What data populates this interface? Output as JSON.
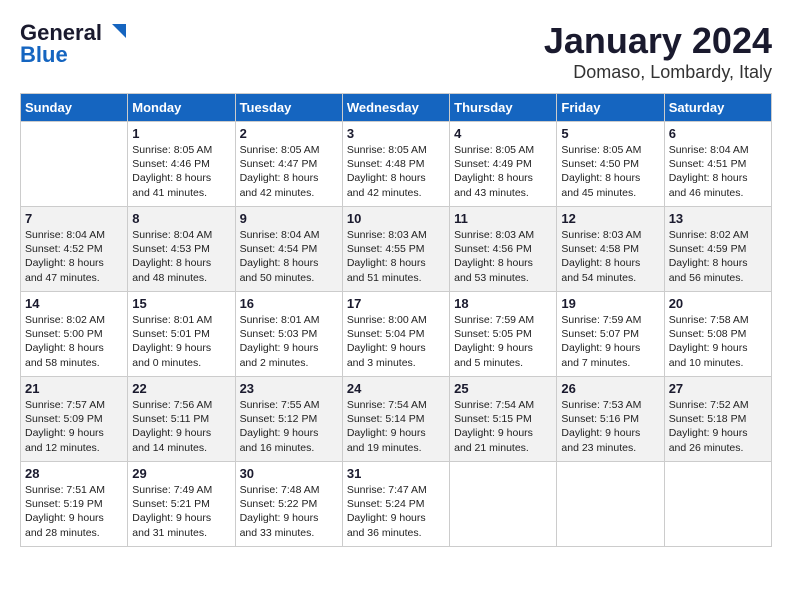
{
  "header": {
    "logo_general": "General",
    "logo_blue": "Blue",
    "month": "January 2024",
    "location": "Domaso, Lombardy, Italy"
  },
  "days_of_week": [
    "Sunday",
    "Monday",
    "Tuesday",
    "Wednesday",
    "Thursday",
    "Friday",
    "Saturday"
  ],
  "weeks": [
    [
      {
        "day": "",
        "info": ""
      },
      {
        "day": "1",
        "info": "Sunrise: 8:05 AM\nSunset: 4:46 PM\nDaylight: 8 hours\nand 41 minutes."
      },
      {
        "day": "2",
        "info": "Sunrise: 8:05 AM\nSunset: 4:47 PM\nDaylight: 8 hours\nand 42 minutes."
      },
      {
        "day": "3",
        "info": "Sunrise: 8:05 AM\nSunset: 4:48 PM\nDaylight: 8 hours\nand 42 minutes."
      },
      {
        "day": "4",
        "info": "Sunrise: 8:05 AM\nSunset: 4:49 PM\nDaylight: 8 hours\nand 43 minutes."
      },
      {
        "day": "5",
        "info": "Sunrise: 8:05 AM\nSunset: 4:50 PM\nDaylight: 8 hours\nand 45 minutes."
      },
      {
        "day": "6",
        "info": "Sunrise: 8:04 AM\nSunset: 4:51 PM\nDaylight: 8 hours\nand 46 minutes."
      }
    ],
    [
      {
        "day": "7",
        "info": "Sunrise: 8:04 AM\nSunset: 4:52 PM\nDaylight: 8 hours\nand 47 minutes."
      },
      {
        "day": "8",
        "info": "Sunrise: 8:04 AM\nSunset: 4:53 PM\nDaylight: 8 hours\nand 48 minutes."
      },
      {
        "day": "9",
        "info": "Sunrise: 8:04 AM\nSunset: 4:54 PM\nDaylight: 8 hours\nand 50 minutes."
      },
      {
        "day": "10",
        "info": "Sunrise: 8:03 AM\nSunset: 4:55 PM\nDaylight: 8 hours\nand 51 minutes."
      },
      {
        "day": "11",
        "info": "Sunrise: 8:03 AM\nSunset: 4:56 PM\nDaylight: 8 hours\nand 53 minutes."
      },
      {
        "day": "12",
        "info": "Sunrise: 8:03 AM\nSunset: 4:58 PM\nDaylight: 8 hours\nand 54 minutes."
      },
      {
        "day": "13",
        "info": "Sunrise: 8:02 AM\nSunset: 4:59 PM\nDaylight: 8 hours\nand 56 minutes."
      }
    ],
    [
      {
        "day": "14",
        "info": "Sunrise: 8:02 AM\nSunset: 5:00 PM\nDaylight: 8 hours\nand 58 minutes."
      },
      {
        "day": "15",
        "info": "Sunrise: 8:01 AM\nSunset: 5:01 PM\nDaylight: 9 hours\nand 0 minutes."
      },
      {
        "day": "16",
        "info": "Sunrise: 8:01 AM\nSunset: 5:03 PM\nDaylight: 9 hours\nand 2 minutes."
      },
      {
        "day": "17",
        "info": "Sunrise: 8:00 AM\nSunset: 5:04 PM\nDaylight: 9 hours\nand 3 minutes."
      },
      {
        "day": "18",
        "info": "Sunrise: 7:59 AM\nSunset: 5:05 PM\nDaylight: 9 hours\nand 5 minutes."
      },
      {
        "day": "19",
        "info": "Sunrise: 7:59 AM\nSunset: 5:07 PM\nDaylight: 9 hours\nand 7 minutes."
      },
      {
        "day": "20",
        "info": "Sunrise: 7:58 AM\nSunset: 5:08 PM\nDaylight: 9 hours\nand 10 minutes."
      }
    ],
    [
      {
        "day": "21",
        "info": "Sunrise: 7:57 AM\nSunset: 5:09 PM\nDaylight: 9 hours\nand 12 minutes."
      },
      {
        "day": "22",
        "info": "Sunrise: 7:56 AM\nSunset: 5:11 PM\nDaylight: 9 hours\nand 14 minutes."
      },
      {
        "day": "23",
        "info": "Sunrise: 7:55 AM\nSunset: 5:12 PM\nDaylight: 9 hours\nand 16 minutes."
      },
      {
        "day": "24",
        "info": "Sunrise: 7:54 AM\nSunset: 5:14 PM\nDaylight: 9 hours\nand 19 minutes."
      },
      {
        "day": "25",
        "info": "Sunrise: 7:54 AM\nSunset: 5:15 PM\nDaylight: 9 hours\nand 21 minutes."
      },
      {
        "day": "26",
        "info": "Sunrise: 7:53 AM\nSunset: 5:16 PM\nDaylight: 9 hours\nand 23 minutes."
      },
      {
        "day": "27",
        "info": "Sunrise: 7:52 AM\nSunset: 5:18 PM\nDaylight: 9 hours\nand 26 minutes."
      }
    ],
    [
      {
        "day": "28",
        "info": "Sunrise: 7:51 AM\nSunset: 5:19 PM\nDaylight: 9 hours\nand 28 minutes."
      },
      {
        "day": "29",
        "info": "Sunrise: 7:49 AM\nSunset: 5:21 PM\nDaylight: 9 hours\nand 31 minutes."
      },
      {
        "day": "30",
        "info": "Sunrise: 7:48 AM\nSunset: 5:22 PM\nDaylight: 9 hours\nand 33 minutes."
      },
      {
        "day": "31",
        "info": "Sunrise: 7:47 AM\nSunset: 5:24 PM\nDaylight: 9 hours\nand 36 minutes."
      },
      {
        "day": "",
        "info": ""
      },
      {
        "day": "",
        "info": ""
      },
      {
        "day": "",
        "info": ""
      }
    ]
  ]
}
